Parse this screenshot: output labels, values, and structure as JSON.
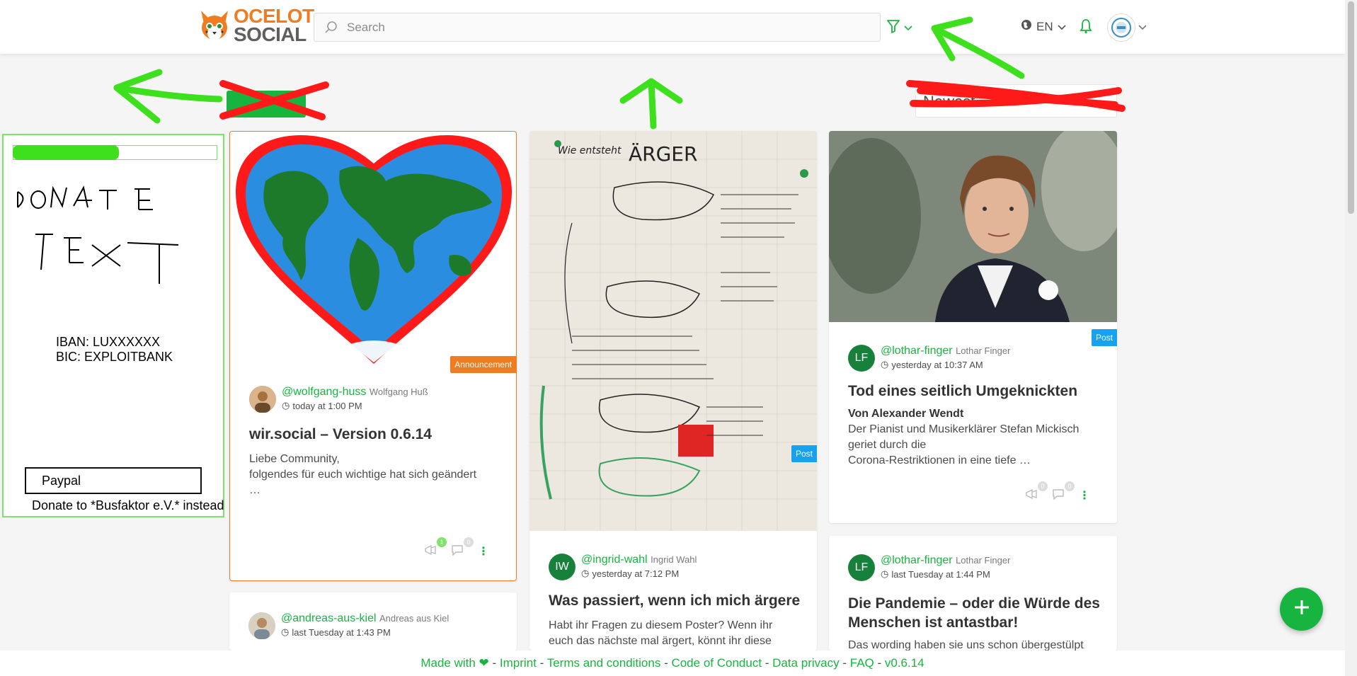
{
  "header": {
    "logo_line1": "OCELOT",
    "logo_line2": "SOCIAL",
    "search_placeholder": "Search",
    "language": "EN"
  },
  "sort": {
    "selected": "Newest"
  },
  "donate": {
    "handwritten_text": "DONATE TEXT",
    "iban": "IBAN: LUXXXXXX",
    "bic": "BIC: EXPLOITBANK",
    "paypal_label": "Paypal",
    "instead_text": "Donate to *Busfaktor e.V.* instead"
  },
  "posts": [
    {
      "badge": "Announcement",
      "author_handle": "@wolfgang-huss",
      "author_name": "Wolfgang Huß",
      "time": "today at 1:00 PM",
      "title": "wir.social – Version 0.6.14",
      "text_line1": "Liebe Community,",
      "text_line2": "folgendes für euch wichtige hat sich geändert",
      "text_line3": "…",
      "shouts": "1",
      "comments": "0"
    },
    {
      "author_handle": "@andreas-aus-kiel",
      "author_name": "Andreas aus Kiel",
      "time": "last Tuesday at 1:43 PM"
    },
    {
      "badge": "Post",
      "author_initials": "IW",
      "author_handle": "@ingrid-wahl",
      "author_name": "Ingrid Wahl",
      "time": "yesterday at 7:12 PM",
      "title": "Was passiert, wenn ich mich ärgere",
      "text_line1": "Habt ihr Fragen zu diesem Poster? Wenn ihr",
      "text_line2": "euch das nächste mal ärgert, könnt ihr diese",
      "poster_title": "ÄRGER",
      "poster_subtitle": "Wie entsteht"
    },
    {
      "badge": "Post",
      "author_initials": "LF",
      "author_handle": "@lothar-finger",
      "author_name": "Lothar Finger",
      "time": "yesterday at 10:37 AM",
      "title": "Tod eines seitlich Umgeknickten",
      "text_bold": "Von Alexander Wendt",
      "text_line1": "Der Pianist und Musikerklärer Stefan Mickisch",
      "text_line2": "geriet durch die",
      "text_line3": "Corona-Restriktionen in eine tiefe …",
      "shouts": "0",
      "comments": "0"
    },
    {
      "author_initials": "LF",
      "author_handle": "@lothar-finger",
      "author_name": "Lothar Finger",
      "time": "last Tuesday at 1:44 PM",
      "title_line1": "Die Pandemie – oder die Würde des",
      "title_line2": "Menschen ist antastbar!",
      "text_line1": "Das wording haben sie uns schon übergestülpt"
    }
  ],
  "footer": {
    "made_with": "Made with ❤",
    "imprint": "Imprint",
    "terms": "Terms and conditions",
    "conduct": "Code of Conduct",
    "privacy": "Data privacy",
    "faq": "FAQ",
    "version": "v0.6.14"
  },
  "colors": {
    "primary": "#17b53f",
    "accent": "#ef7c20",
    "post_badge": "#17a2f0",
    "annotation_green": "#3ee01e",
    "annotation_red": "#ff1a1a"
  }
}
